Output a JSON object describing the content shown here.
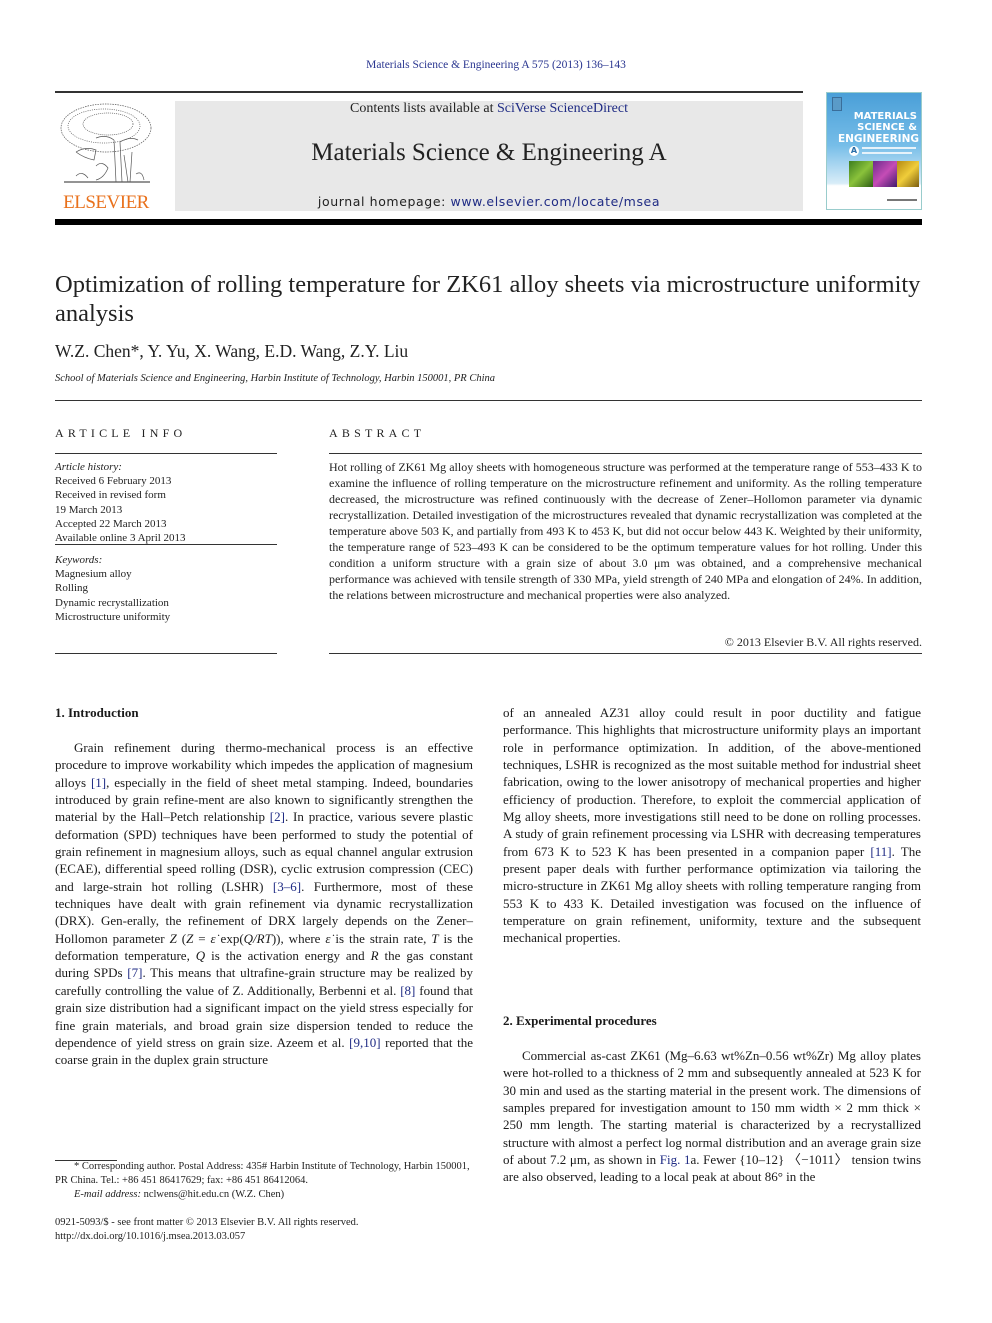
{
  "header": {
    "citation": "Materials Science & Engineering A 575 (2013) 136–143",
    "contents_prefix": "Contents lists available at ",
    "contents_link": "SciVerse ScienceDirect",
    "journal_title": "Materials Science & Engineering A",
    "homepage_prefix": "journal homepage: ",
    "homepage_link": "www.elsevier.com/locate/msea",
    "publisher_logo_text": "ELSEVIER",
    "cover": {
      "line1": "MATERIALS",
      "line2": "SCIENCE &",
      "line3": "ENGINEERING",
      "letter": "A"
    },
    "colors": {
      "elsevier_orange": "#e9711c",
      "link_blue": "#1f2b84",
      "header_gray": "#e8e8e8"
    }
  },
  "article": {
    "title": "Optimization of rolling temperature for ZK61 alloy sheets via microstructure uniformity analysis",
    "authors": "W.Z. Chen*, Y. Yu, X. Wang, E.D. Wang, Z.Y. Liu",
    "affiliation": "School of Materials Science and Engineering, Harbin Institute of Technology, Harbin 150001, PR China"
  },
  "article_info": {
    "heading": "ARTICLE INFO",
    "history_label": "Article history:",
    "history": [
      "Received 6 February 2013",
      "Received in revised form",
      "19 March 2013",
      "Accepted 22 March 2013",
      "Available online 3 April 2013"
    ],
    "keywords_label": "Keywords:",
    "keywords": [
      "Magnesium alloy",
      "Rolling",
      "Dynamic recrystallization",
      "Microstructure uniformity"
    ]
  },
  "abstract": {
    "heading": "ABSTRACT",
    "text": "Hot rolling of ZK61 Mg alloy sheets with homogeneous structure was performed at the temperature range of 553–433 K to examine the influence of rolling temperature on the microstructure refinement and uniformity. As the rolling temperature decreased, the microstructure was refined continuously with the decrease of Zener–Hollomon parameter via dynamic recrystallization. Detailed investigation of the microstructures revealed that dynamic recrystallization was completed at the temperature above 503 K, and partially from 493 K to 453 K, but did not occur below 443 K. Weighted by their uniformity, the temperature range of 523–493 K can be considered to be the optimum temperature values for hot rolling. Under this condition a uniform structure with a grain size of about 3.0 μm was obtained, and a comprehensive mechanical performance was achieved with tensile strength of 330 MPa, yield strength of 240 MPa and elongation of 24%. In addition, the relations between microstructure and mechanical properties were also analyzed.",
    "copyright": "© 2013 Elsevier B.V. All rights reserved."
  },
  "sections": {
    "intro_heading": "1.  Introduction",
    "intro_p1": [
      {
        "t": "Grain refinement during thermo-mechanical process is an effective procedure to improve workability which impedes the application of magnesium alloys "
      },
      {
        "ref": "[1]"
      },
      {
        "t": ", especially in the field of sheet metal stamping. Indeed, boundaries introduced by grain refine-ment are also known to significantly strengthen the material by the Hall–Petch relationship "
      },
      {
        "ref": "[2]"
      },
      {
        "t": ". In practice, various severe plastic deformation (SPD) techniques have been performed to study the potential of grain refinement in magnesium alloys, such as equal channel angular extrusion (ECAE), differential speed rolling (DSR), cyclic extrusion compression (CEC) and large-strain hot rolling (LSHR) "
      },
      {
        "ref": "[3–6]"
      },
      {
        "t": ". Furthermore, most of these techniques have dealt with grain refinement via dynamic recrystallization (DRX). Gen-erally, the refinement of DRX largely depends on the Zener–Hollomon parameter "
      },
      {
        "i": "Z"
      },
      {
        "t": " ("
      },
      {
        "i": "Z"
      },
      {
        "t": " = "
      },
      {
        "i": "ε̇"
      },
      {
        "t": " exp("
      },
      {
        "i": "Q/RT"
      },
      {
        "t": ")), where "
      },
      {
        "i": "ε̇"
      },
      {
        "t": " is the strain rate, "
      },
      {
        "i": "T"
      },
      {
        "t": " is the deformation temperature, "
      },
      {
        "i": "Q"
      },
      {
        "t": " is the activation energy and "
      },
      {
        "i": "R"
      },
      {
        "t": " the gas constant during SPDs "
      },
      {
        "ref": "[7]"
      },
      {
        "t": ". This means that ultrafine-grain structure may be realized by carefully controlling the value of Z. Additionally, Berbenni et al. "
      },
      {
        "ref": "[8]"
      },
      {
        "t": " found that grain size distribution had a significant impact on the yield stress especially for fine grain materials, and broad grain size dispersion tended to reduce the dependence of yield stress on grain size. Azeem et al. "
      },
      {
        "ref": "[9,10]"
      },
      {
        "t": " reported that the coarse grain in the duplex grain structure"
      }
    ],
    "intro_p1_cont": [
      {
        "t": "of an annealed AZ31 alloy could result in poor ductility and fatigue performance. This highlights that microstructure uniformity plays an important role in performance optimization. In addition, of the above-mentioned techniques, LSHR is recognized as the most suitable method for industrial sheet fabrication, owing to the lower anisotropy of mechanical properties and higher efficiency of production. Therefore, to exploit the commercial application of Mg alloy sheets, more investigations still need to be done on rolling processes. A study of grain refinement processing via LSHR with decreasing temperatures from 673 K to 523 K has been presented in a companion paper "
      },
      {
        "ref": "[11]"
      },
      {
        "t": ". The present paper deals with further performance optimization via tailoring the micro-structure in ZK61 Mg alloy sheets with rolling temperature ranging from 553 K to 433 K. Detailed investigation was focused on the influence of temperature on grain refinement, uniformity, texture and the subsequent mechanical properties."
      }
    ],
    "exp_heading": "2.  Experimental procedures",
    "exp_p1": [
      {
        "t": "Commercial as-cast ZK61 (Mg–6.63 wt%Zn–0.56 wt%Zr) Mg alloy plates were hot-rolled to a thickness of 2 mm and subsequently annealed at 523 K for 30 min and used as the starting material in the present work. The dimensions of samples prepared for investigation amount to 150 mm width × 2 mm thick × 250 mm length. The starting material is characterized by a recrystallized structure with almost a perfect log normal distribution and an average grain size of about 7.2 μm, as shown in "
      },
      {
        "ref": "Fig. 1"
      },
      {
        "t": "a. Fewer {10–12} 〈−1011〉 tension twins are also observed, leading to a local peak at about 86° in the"
      }
    ]
  },
  "footnotes": {
    "corresponding": "* Corresponding author. Postal Address: 435# Harbin Institute of Technology, Harbin 150001, PR China. Tel.: +86 451 86417629; fax: +86 451 86412064.",
    "email_label": "E-mail address:",
    "email": " nclwens@hit.edu.cn (W.Z. Chen)",
    "issn": "0921-5093/$ - see front matter © 2013 Elsevier B.V. All rights reserved.",
    "doi": "http://dx.doi.org/10.1016/j.msea.2013.03.057"
  }
}
